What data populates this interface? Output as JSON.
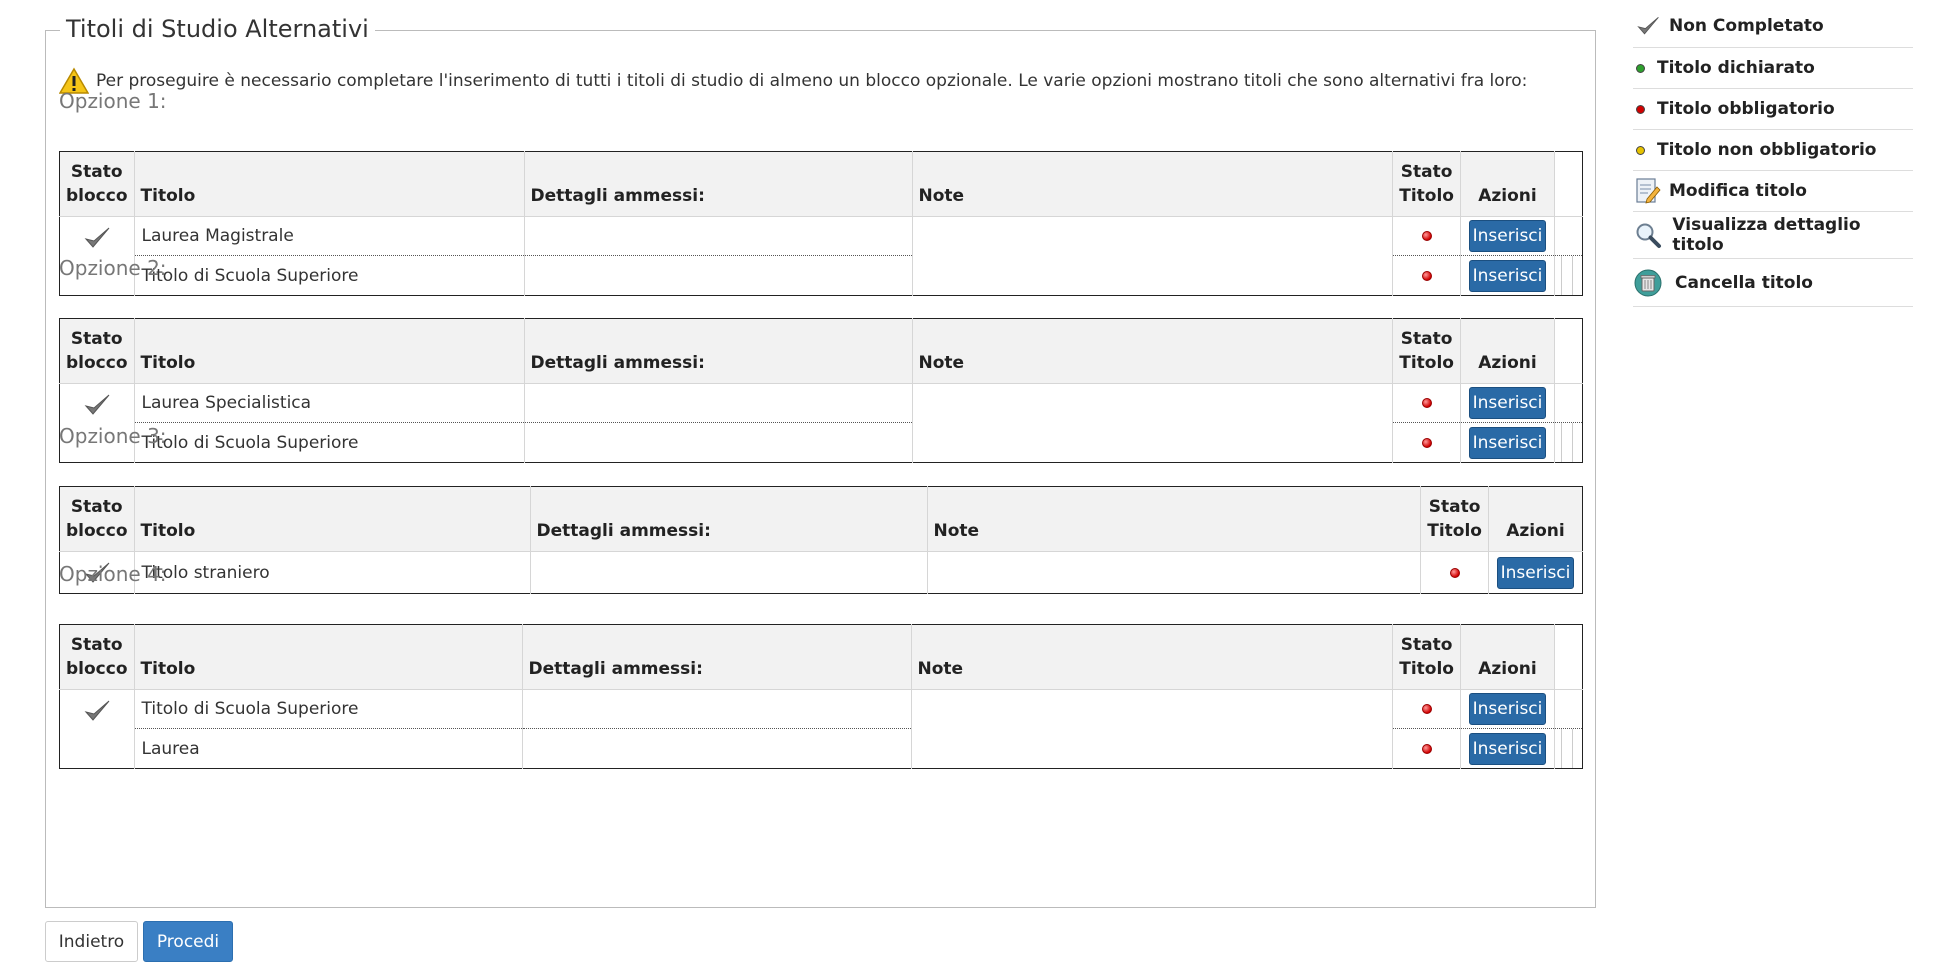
{
  "section": {
    "title": "Titoli di Studio Alternativi",
    "warning": "Per proseguire è necessario completare l'inserimento di tutti i titoli di studio di almeno un blocco opzionale. Le varie opzioni mostrano titoli che sono alternativi fra loro:"
  },
  "table_headers": {
    "stato_blocco_1": "Stato",
    "stato_blocco_2": "blocco",
    "titolo": "Titolo",
    "dettagli": "Dettagli ammessi:",
    "note": "Note",
    "stato_titolo_1": "Stato",
    "stato_titolo_2": "Titolo",
    "azioni": "Azioni"
  },
  "options": [
    {
      "title": "Opzione 1:",
      "rows": [
        {
          "titolo": "Laurea Magistrale",
          "button": "Inserisci"
        },
        {
          "titolo": "Titolo di Scuola Superiore",
          "button": "Inserisci"
        }
      ]
    },
    {
      "title": "Opzione 2:",
      "rows": [
        {
          "titolo": "Laurea Specialistica",
          "button": "Inserisci"
        },
        {
          "titolo": "Titolo di Scuola Superiore",
          "button": "Inserisci"
        }
      ]
    },
    {
      "title": "Opzione 3:",
      "rows": [
        {
          "titolo": "Titolo straniero",
          "button": "Inserisci"
        }
      ]
    },
    {
      "title": "Opzione 4:",
      "rows": [
        {
          "titolo": "Titolo di Scuola Superiore",
          "button": "Inserisci"
        },
        {
          "titolo": "Laurea",
          "button": "Inserisci"
        }
      ]
    }
  ],
  "buttons": {
    "back": "Indietro",
    "next": "Procedi"
  },
  "legend": [
    {
      "icon": "check-icon",
      "label": "Non Completato"
    },
    {
      "icon": "green-dot-icon",
      "label": "Titolo dichiarato",
      "color": "#2ea02e"
    },
    {
      "icon": "red-dot-icon",
      "label": "Titolo obbligatorio",
      "color": "#d10000"
    },
    {
      "icon": "yellow-dot-icon",
      "label": "Titolo non obbligatorio",
      "color": "#e6c200"
    },
    {
      "icon": "edit-icon",
      "label": "Modifica titolo"
    },
    {
      "icon": "magnifier-icon",
      "label": "Visualizza dettaglio titolo"
    },
    {
      "icon": "trash-icon",
      "label": "Cancella titolo"
    }
  ],
  "colors": {
    "button_primary": "#2a6aa6",
    "procedi": "#3a7fc4"
  }
}
